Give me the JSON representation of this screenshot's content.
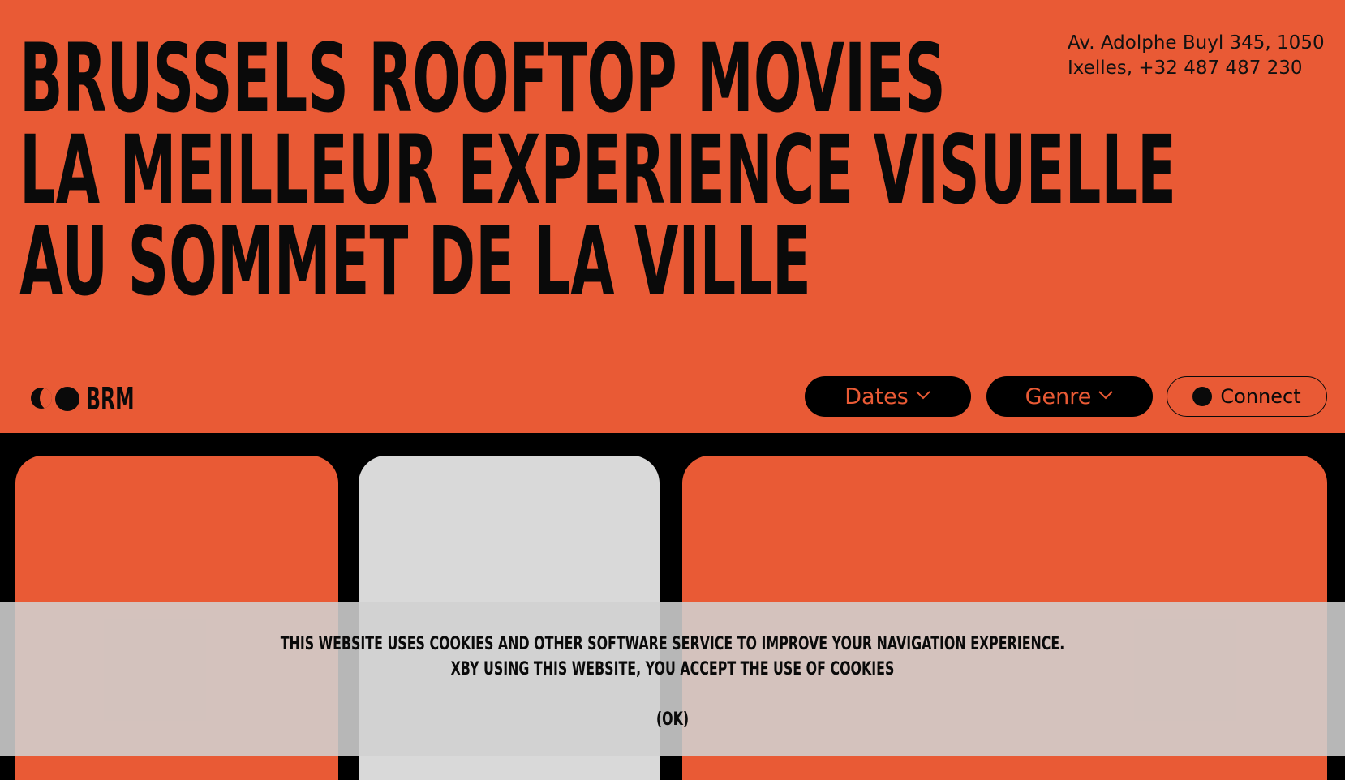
{
  "header": {
    "headline_lines": [
      "BRUSSELS ROOFTOP MOVIES",
      "LA MEILLEUR EXPERIENCE VISUELLE",
      "AU SOMMET DE LA VILLE"
    ],
    "address_lines": [
      "Av. Adolphe Buyl 345, 1050",
      "Ixelles, +32 487 487 230"
    ]
  },
  "nav": {
    "logo_text": "BRM",
    "dates_label": "Dates",
    "genre_label": "Genre",
    "connect_label": "Connect",
    "icons": {
      "dates": "chevron-down-icon",
      "genre": "chevron-down-icon",
      "connect": "dot-icon"
    }
  },
  "cards": [
    {
      "name": "card-1",
      "color": "#E95A35"
    },
    {
      "name": "card-2",
      "color": "#D9D9D9"
    },
    {
      "name": "card-3",
      "color": "#E95A35"
    }
  ],
  "cookie_banner": {
    "lines": [
      "THIS WEBSITE USES COOKIES AND OTHER SOFTWARE SERVICE TO IMPROVE YOUR NAVIGATION EXPERIENCE.",
      "XBY USING THIS WEBSITE, YOU ACCEPT THE USE OF COOKIES"
    ],
    "ok_label": "(OK)"
  },
  "colors": {
    "accent": "#E95A35",
    "dark": "#000000",
    "card_gray": "#D9D9D9",
    "overlay": "#D0D0D0"
  }
}
